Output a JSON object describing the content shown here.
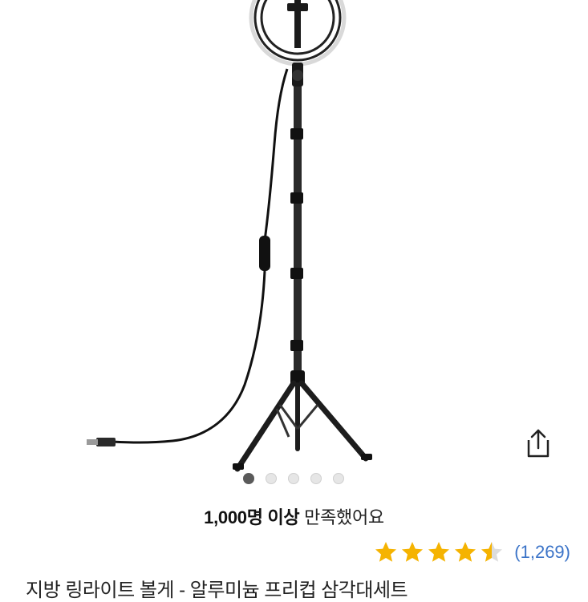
{
  "product": {
    "image_alt": "ring light on tripod stand",
    "title_partial": "지방 링라이트 볼게 - 알루미늄 프리컵 삼각대세트"
  },
  "gallery": {
    "total": 5,
    "active_index": 0
  },
  "share": {
    "icon": "share-icon"
  },
  "satisfaction": {
    "highlight": "1,000명 이상",
    "suffix": "만족했어요"
  },
  "rating": {
    "stars": 4.5,
    "count_label": "(1,269)",
    "star_color": "#f5b301",
    "empty_color": "#dcdcdc"
  },
  "colors": {
    "link": "#3c74c8",
    "dot_active": "#5a5a5a",
    "dot_inactive": "#e6e6e6"
  }
}
